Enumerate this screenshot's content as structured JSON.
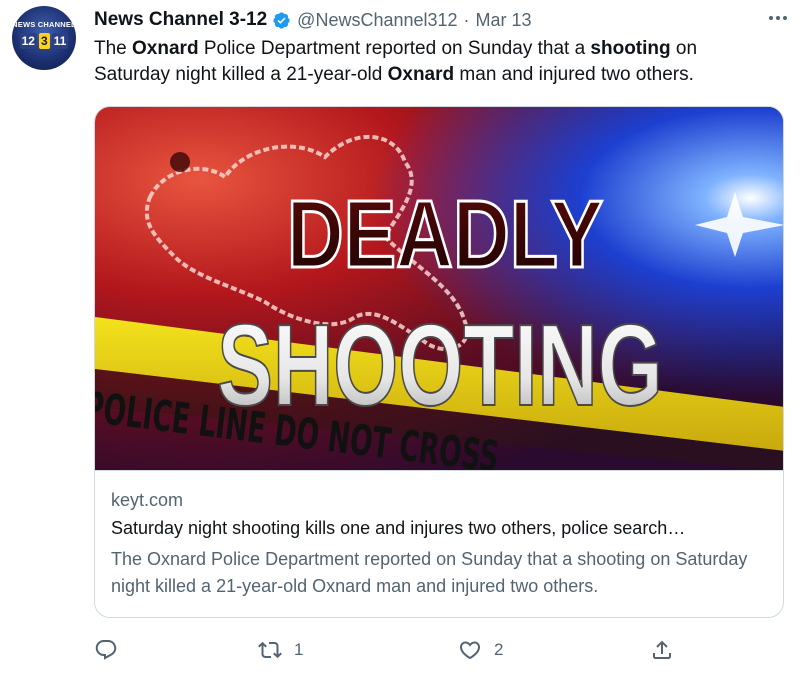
{
  "tweet": {
    "display_name": "News Channel 3-12",
    "handle": "@NewsChannel312",
    "separator": "·",
    "date": "Mar 13",
    "text_segments": [
      {
        "text": "The ",
        "bold": false
      },
      {
        "text": "Oxnard",
        "bold": true
      },
      {
        "text": " Police Department reported on Sunday that a ",
        "bold": false
      },
      {
        "text": "shooting",
        "bold": true
      },
      {
        "text": " on Saturday night killed a 21-year-old ",
        "bold": false
      },
      {
        "text": "Oxnard",
        "bold": true
      },
      {
        "text": " man and injured two others.",
        "bold": false
      }
    ]
  },
  "avatar": {
    "top_text": "NEWS CHANNEL",
    "numbers": [
      "12",
      "3",
      "11"
    ]
  },
  "card": {
    "image_text_line1": "DEADLY",
    "image_text_line2": "SHOOTING",
    "tape_text": "POLICE LINE DO NOT CROSS",
    "domain": "keyt.com",
    "title": "Saturday night shooting kills one and injures two others, police search…",
    "description": "The Oxnard Police Department reported on Sunday that a shooting on Saturday night killed a 21-year-old Oxnard man and injured two others."
  },
  "actions": {
    "reply_count": "",
    "retweet_count": "1",
    "like_count": "2"
  },
  "colors": {
    "verified": "#1d9bf0",
    "secondary_text": "#536471",
    "border": "#cfd9de"
  },
  "icons": [
    "verified-badge-icon",
    "more-icon",
    "reply-icon",
    "retweet-icon",
    "like-icon",
    "share-icon"
  ]
}
